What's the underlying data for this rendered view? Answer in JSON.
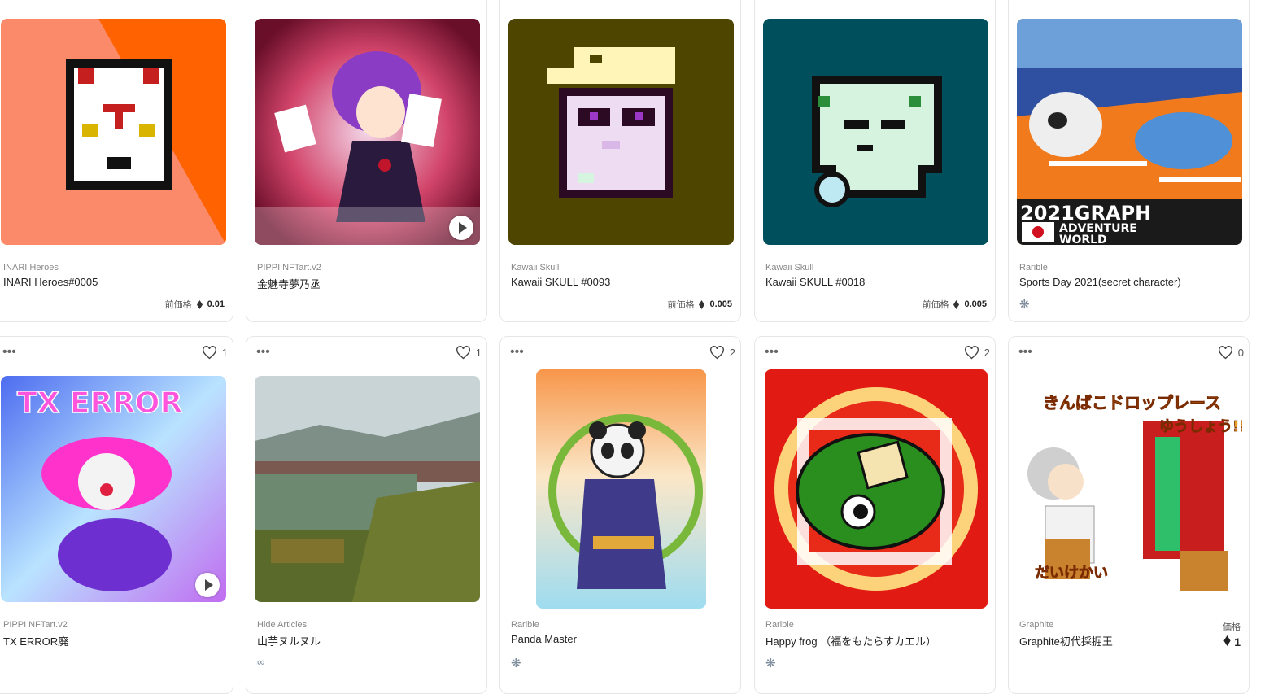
{
  "cards": [
    {
      "collection": "INARI Heroes",
      "title": "INARI Heroes#0005",
      "price_label": "前価格",
      "price_value": "0.01"
    },
    {
      "collection": "PIPPI NFTart.v2",
      "title": "金魅寺夢乃丞"
    },
    {
      "collection": "Kawaii Skull",
      "title": "Kawaii SKULL #0093",
      "price_label": "前価格",
      "price_value": "0.005"
    },
    {
      "collection": "Kawaii Skull",
      "title": "Kawaii SKULL #0018",
      "price_label": "前価格",
      "price_value": "0.005"
    },
    {
      "collection": "Rarible",
      "title": "Sports Day 2021(secret character)",
      "badge_icon": "rarible-icon"
    },
    {
      "collection": "PIPPI NFTart.v2",
      "title": "TX ERROR廃",
      "likes": "1"
    },
    {
      "collection": "Hide Articles",
      "title": "山芋ヌルヌル",
      "likes": "1",
      "badge_icon": "link-icon"
    },
    {
      "collection": "Rarible",
      "title": "Panda Master",
      "likes": "2",
      "badge_icon": "rarible-icon"
    },
    {
      "collection": "Rarible",
      "title": "Happy frog （福をもたらすカエル）",
      "likes": "2",
      "badge_icon": "rarible-icon"
    },
    {
      "collection": "Graphite",
      "title": "Graphite初代採掘王",
      "likes": "0",
      "price_label": "価格",
      "price_value": "1"
    }
  ],
  "image_text": {
    "card2": "金魅寺夢乃丞",
    "card5_line1": "2021GRAPH",
    "card5_line2": "ADVENTURE",
    "card5_line3": "WORLD",
    "card6": "TX ERROR",
    "card10_line1": "きんばこドロップレース",
    "card10_line2": "ゆうしょう!!",
    "card10_line3": "だいけかい"
  },
  "icons": {
    "more": "more-dots-icon",
    "like": "heart-icon",
    "currency": "eth-icon",
    "video": "play-icon"
  },
  "colors": {
    "border": "#e6e6e6",
    "text": "#1f1f1f",
    "muted": "#888888"
  }
}
